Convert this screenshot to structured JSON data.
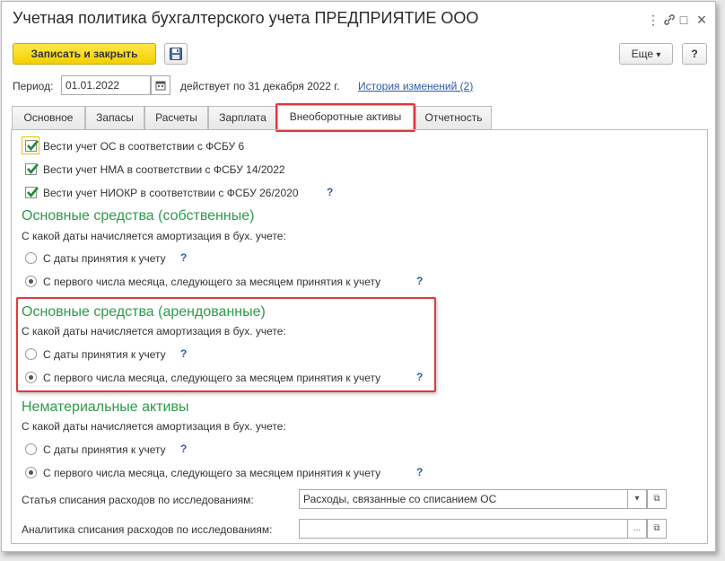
{
  "window": {
    "title": "Учетная политика бухгалтерского учета ПРЕДПРИЯТИЕ ООО",
    "controls": {
      "more": "⋮",
      "link": "🔗",
      "maximize": "□",
      "close": "×"
    }
  },
  "toolbar": {
    "save_close_label": "Записать и закрыть",
    "more_label": "Еще",
    "more_arrow": "▾",
    "help_label": "?"
  },
  "period": {
    "label": "Период:",
    "value": "01.01.2022",
    "valid_text": "действует по 31 декабря 2022 г.",
    "history_link": "История изменений (2)"
  },
  "tabs": [
    {
      "label": "Основное"
    },
    {
      "label": "Запасы"
    },
    {
      "label": "Расчеты"
    },
    {
      "label": "Зарплата"
    },
    {
      "label": "Внеоборотные активы"
    },
    {
      "label": "Отчетность"
    }
  ],
  "checkboxes": [
    {
      "label": "Вести учет ОС в соответствии с ФСБУ 6",
      "checked": true
    },
    {
      "label": "Вести учет НМА в соответствии с ФСБУ 14/2022",
      "checked": true
    },
    {
      "label": "Вести учет НИОКР в соответствии с ФСБУ 26/2020",
      "checked": true,
      "help": "?"
    }
  ],
  "sections": [
    {
      "title": "Основные средства (собственные)",
      "question": "С какой даты начисляется амортизация в бух. учете:",
      "options": [
        {
          "label": "С даты принятия к учету",
          "help": "?"
        },
        {
          "label": "С первого числа месяца, следующего за месяцем принятия к учету",
          "help": "?"
        }
      ],
      "selected": 1
    },
    {
      "title": "Основные средства (арендованные)",
      "question": "С какой даты начисляется амортизация в бух. учете:",
      "options": [
        {
          "label": "С даты принятия к учету",
          "help": "?"
        },
        {
          "label": "С первого числа месяца, следующего за месяцем принятия к учету",
          "help": "?"
        }
      ],
      "selected": 1
    },
    {
      "title": "Нематериальные активы",
      "question": "С какой даты начисляется амортизация в бух. учете:",
      "options": [
        {
          "label": "С даты принятия к учету",
          "help": "?"
        },
        {
          "label": "С первого числа месяца, следующего за месяцем принятия к учету",
          "help": "?"
        }
      ],
      "selected": 1
    }
  ],
  "fields": {
    "expense_item": {
      "label": "Статья списания расходов по исследованиям:",
      "value": "Расходы, связанные со списанием ОС",
      "dropdown": "▾",
      "open": "⧉"
    },
    "analytics": {
      "label": "Аналитика списания расходов по исследованиям:",
      "value": "",
      "choose": "...",
      "open": "⧉"
    }
  },
  "colors": {
    "accent_yellow": "#f3cf00",
    "section_green": "#2e9a4a",
    "highlight_red": "#e2373c",
    "link_blue": "#2f5aa8"
  }
}
